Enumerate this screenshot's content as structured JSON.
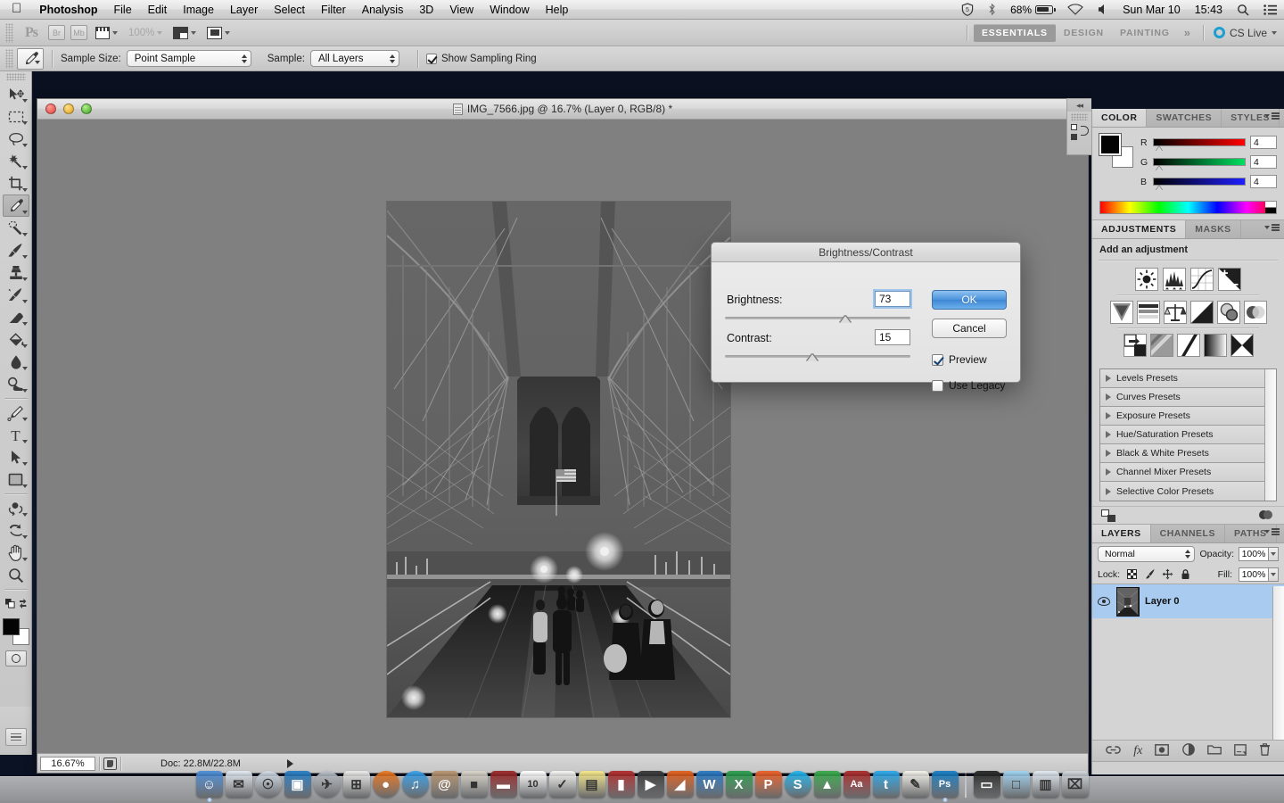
{
  "menubar": {
    "apple_icon": "apple-icon",
    "items": [
      {
        "label": "Photoshop",
        "bold": true
      },
      {
        "label": "File",
        "bold": false
      },
      {
        "label": "Edit",
        "bold": false
      },
      {
        "label": "Image",
        "bold": false
      },
      {
        "label": "Layer",
        "bold": false
      },
      {
        "label": "Select",
        "bold": false
      },
      {
        "label": "Filter",
        "bold": false
      },
      {
        "label": "Analysis",
        "bold": false
      },
      {
        "label": "3D",
        "bold": false
      },
      {
        "label": "View",
        "bold": false
      },
      {
        "label": "Window",
        "bold": false
      },
      {
        "label": "Help",
        "bold": false
      }
    ],
    "status": {
      "shield_icon": "security-shield-icon",
      "bluetooth_icon": "bluetooth-icon",
      "battery_percent": "68%",
      "wifi_icon": "wifi-icon",
      "volume_icon": "volume-icon",
      "date": "Sun Mar 10",
      "time": "15:43",
      "spotlight_icon": "search-icon",
      "notifications_icon": "list-icon"
    }
  },
  "appbar": {
    "logo": "Ps",
    "bridge_label": "Br",
    "minibridge_label": "Mb",
    "view_extras_icon": "view-extras-icon",
    "zoom_level": "100%",
    "arrange_documents_icon": "arrange-documents-icon",
    "screen_mode_icon": "screen-mode-icon",
    "workspaces": [
      {
        "label": "ESSENTIALS",
        "active": true
      },
      {
        "label": "DESIGN",
        "active": false
      },
      {
        "label": "PAINTING",
        "active": false
      }
    ],
    "more_workspaces": "»",
    "cs_live": "CS Live"
  },
  "options_bar": {
    "tool_icon": "eyedropper-icon",
    "sample_size_label": "Sample Size:",
    "sample_size_value": "Point Sample",
    "sample_label": "Sample:",
    "sample_value": "All Layers",
    "show_sampling_ring_label": "Show Sampling Ring",
    "show_sampling_ring_checked": true
  },
  "toolbar": {
    "tools": [
      {
        "name": "move-tool",
        "glyph": "move",
        "selected": false,
        "has_flyout": true
      },
      {
        "name": "rectangular-marquee-tool",
        "glyph": "marquee",
        "selected": false,
        "has_flyout": true
      },
      {
        "name": "lasso-tool",
        "glyph": "lasso",
        "selected": false,
        "has_flyout": true
      },
      {
        "name": "quick-selection-tool",
        "glyph": "wand",
        "selected": false,
        "has_flyout": true
      },
      {
        "name": "crop-tool",
        "glyph": "crop",
        "selected": false,
        "has_flyout": true
      },
      {
        "name": "eyedropper-tool",
        "glyph": "eyedropper",
        "selected": true,
        "has_flyout": true
      },
      {
        "name": "spot-healing-brush-tool",
        "glyph": "healing",
        "selected": false,
        "has_flyout": true
      },
      {
        "name": "brush-tool",
        "glyph": "brush",
        "selected": false,
        "has_flyout": true
      },
      {
        "name": "clone-stamp-tool",
        "glyph": "stamp",
        "selected": false,
        "has_flyout": true
      },
      {
        "name": "history-brush-tool",
        "glyph": "historybrush",
        "selected": false,
        "has_flyout": true
      },
      {
        "name": "eraser-tool",
        "glyph": "eraser",
        "selected": false,
        "has_flyout": true
      },
      {
        "name": "gradient-tool",
        "glyph": "paintbucket",
        "selected": false,
        "has_flyout": true
      },
      {
        "name": "blur-tool",
        "glyph": "blur",
        "selected": false,
        "has_flyout": true
      },
      {
        "name": "dodge-tool",
        "glyph": "dodge",
        "selected": false,
        "has_flyout": true
      },
      {
        "name": "pen-tool",
        "glyph": "pen",
        "selected": false,
        "has_flyout": true
      },
      {
        "name": "horizontal-type-tool",
        "glyph": "type",
        "selected": false,
        "has_flyout": true
      },
      {
        "name": "path-selection-tool",
        "glyph": "pathselect",
        "selected": false,
        "has_flyout": true
      },
      {
        "name": "rectangle-tool",
        "glyph": "shape",
        "selected": false,
        "has_flyout": true
      },
      {
        "name": "rotate-3d-object-tool",
        "glyph": "rotate3d",
        "selected": false,
        "has_flyout": true
      },
      {
        "name": "rotate-3d-camera-tool",
        "glyph": "camera3d",
        "selected": false,
        "has_flyout": true
      },
      {
        "name": "hand-tool",
        "glyph": "hand",
        "selected": false,
        "has_flyout": true
      },
      {
        "name": "zoom-tool",
        "glyph": "zoom",
        "selected": false,
        "has_flyout": false
      }
    ],
    "foreground_color": "#040404",
    "background_color": "#ffffff",
    "quick_mask_icon": "quick-mask-icon"
  },
  "document": {
    "title": "IMG_7566.jpg @ 16.7% (Layer 0, RGB/8) *",
    "status_zoom": "16.67%",
    "status_doc": "Doc: 22.8M/22.8M",
    "canvas_background": "#808080"
  },
  "collapse_strip": {
    "collapse_icon": "collapse-panels-icon",
    "history_icon": "history-icon"
  },
  "color_panel": {
    "tabs": [
      {
        "label": "COLOR",
        "active": true
      },
      {
        "label": "SWATCHES",
        "active": false
      },
      {
        "label": "STYLES",
        "active": false
      }
    ],
    "channels": [
      {
        "label": "R",
        "value": "4"
      },
      {
        "label": "G",
        "value": "4"
      },
      {
        "label": "B",
        "value": "4"
      }
    ]
  },
  "adjustments_panel": {
    "tabs": [
      {
        "label": "ADJUSTMENTS",
        "active": true
      },
      {
        "label": "MASKS",
        "active": false
      }
    ],
    "heading": "Add an adjustment",
    "buttons_row1": [
      "brightness-contrast-icon",
      "levels-icon",
      "curves-icon",
      "exposure-icon"
    ],
    "buttons_row2": [
      "vibrance-icon",
      "hue-saturation-icon",
      "color-balance-icon",
      "black-white-icon",
      "photo-filter-icon",
      "channel-mixer-icon"
    ],
    "buttons_row3": [
      "invert-icon",
      "posterize-icon",
      "threshold-icon",
      "gradient-map-icon",
      "selective-color-icon"
    ],
    "presets": [
      "Levels Presets",
      "Curves Presets",
      "Exposure Presets",
      "Hue/Saturation Presets",
      "Black & White Presets",
      "Channel Mixer Presets",
      "Selective Color Presets"
    ],
    "footer_clip_icon": "clip-to-layer-icon",
    "footer_toggle_icon": "toggle-visibility-icon"
  },
  "layers_panel": {
    "tabs": [
      {
        "label": "LAYERS",
        "active": true
      },
      {
        "label": "CHANNELS",
        "active": false
      },
      {
        "label": "PATHS",
        "active": false
      }
    ],
    "blend_mode": "Normal",
    "opacity_label": "Opacity:",
    "opacity_value": "100%",
    "lock_label": "Lock:",
    "lock_icons": [
      "lock-transparency-icon",
      "lock-image-icon",
      "lock-position-icon",
      "lock-all-icon"
    ],
    "fill_label": "Fill:",
    "fill_value": "100%",
    "layers": [
      {
        "name": "Layer 0",
        "visible": true,
        "selected": true
      }
    ],
    "footer_icons": [
      "link-layers-icon",
      "layer-style-fx-icon",
      "add-layer-mask-icon",
      "new-adjustment-layer-icon",
      "new-group-icon",
      "new-layer-icon",
      "delete-layer-icon"
    ],
    "footer_fx_label": "fx"
  },
  "dialog": {
    "title": "Brightness/Contrast",
    "brightness_label": "Brightness:",
    "brightness_value": "73",
    "brightness_slider_pct": 65,
    "contrast_label": "Contrast:",
    "contrast_value": "15",
    "contrast_slider_pct": 47,
    "ok_label": "OK",
    "cancel_label": "Cancel",
    "preview_label": "Preview",
    "preview_checked": true,
    "use_legacy_label": "Use Legacy",
    "use_legacy_checked": false,
    "accent_color": "#4a93dd"
  },
  "dock": {
    "items": [
      {
        "name": "finder",
        "glyph": "☺",
        "color": "#4f8fd6",
        "running": true
      },
      {
        "name": "mail",
        "glyph": "✉",
        "color": "#dfe6ee",
        "running": false
      },
      {
        "name": "safari",
        "glyph": "☉",
        "color": "#cfd9e4",
        "running": false
      },
      {
        "name": "remote-desktop",
        "glyph": "▣",
        "color": "#2b7fc4",
        "running": false
      },
      {
        "name": "launchpad",
        "glyph": "✈",
        "color": "#b9bfc6",
        "running": false
      },
      {
        "name": "calculator",
        "glyph": "⊞",
        "color": "#e8e8e6",
        "running": false
      },
      {
        "name": "firefox",
        "glyph": "●",
        "color": "#e87722",
        "running": false
      },
      {
        "name": "itunes",
        "glyph": "♫",
        "color": "#3aa0e8",
        "running": false
      },
      {
        "name": "address-book",
        "glyph": "@",
        "color": "#b79470",
        "running": false
      },
      {
        "name": "iphoto",
        "glyph": "■",
        "color": "#d8d3c8",
        "running": false
      },
      {
        "name": "dictionary-book",
        "glyph": "▬",
        "color": "#9b2b2b",
        "running": false
      },
      {
        "name": "ical",
        "glyph": "10",
        "color": "#ffffff",
        "running": false
      },
      {
        "name": "reminders",
        "glyph": "✓",
        "color": "#f2f2ee",
        "running": false
      },
      {
        "name": "stickies",
        "glyph": "▤",
        "color": "#f2e58a",
        "running": false
      },
      {
        "name": "keynote",
        "glyph": "▮",
        "color": "#b03030",
        "running": false
      },
      {
        "name": "imovie",
        "glyph": "▶",
        "color": "#3a3a3a",
        "running": false
      },
      {
        "name": "matlab",
        "glyph": "◢",
        "color": "#e06020",
        "running": false
      },
      {
        "name": "word",
        "glyph": "W",
        "color": "#2b79c2",
        "running": false
      },
      {
        "name": "excel",
        "glyph": "X",
        "color": "#2e9e4f",
        "running": false
      },
      {
        "name": "powerpoint",
        "glyph": "P",
        "color": "#e8622b",
        "running": false
      },
      {
        "name": "skype",
        "glyph": "S",
        "color": "#24b3ea",
        "running": false
      },
      {
        "name": "google-drive",
        "glyph": "▲",
        "color": "#3ba94c",
        "running": false
      },
      {
        "name": "dictionary",
        "glyph": "Aa",
        "color": "#ab2f2f",
        "running": false
      },
      {
        "name": "twitter",
        "glyph": "t",
        "color": "#2fa8e8",
        "running": false
      },
      {
        "name": "textedit",
        "glyph": "✎",
        "color": "#f0efe8",
        "running": false
      },
      {
        "name": "photoshop",
        "glyph": "Ps",
        "color": "#1c7fc4",
        "running": true
      },
      {
        "name": "documents-stack",
        "glyph": "▭",
        "color": "#2a2a2a",
        "running": false
      },
      {
        "name": "downloads-folder",
        "glyph": "□",
        "color": "#9fd2ee",
        "running": false
      },
      {
        "name": "recent-items",
        "glyph": "▥",
        "color": "#dfe7ee",
        "running": false
      },
      {
        "name": "trash",
        "glyph": "⌧",
        "color": "#cfd4d8",
        "running": false
      }
    ]
  }
}
